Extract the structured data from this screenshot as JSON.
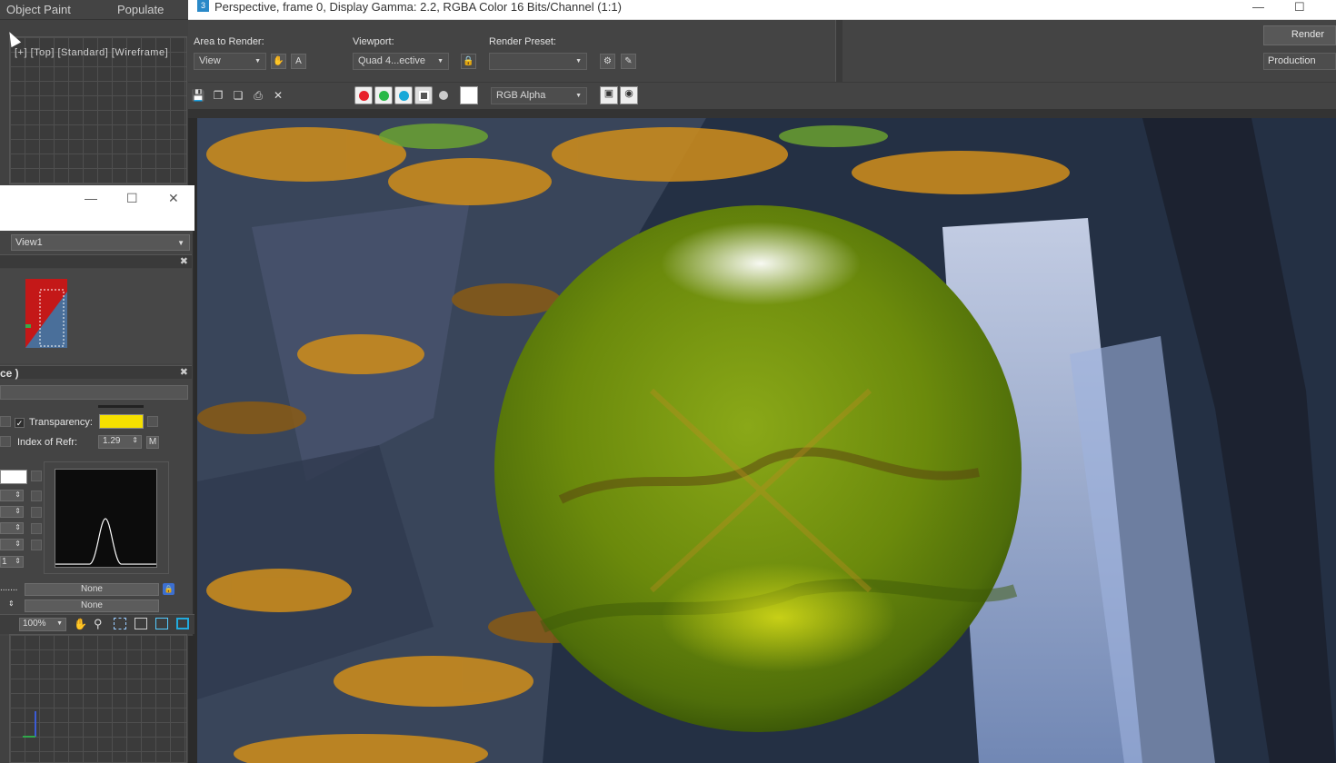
{
  "main_menu": {
    "object_paint": "Object Paint",
    "populate": "Populate"
  },
  "top_viewport": {
    "label": "[+] [Top] [Standard] [Wireframe]"
  },
  "material_editor": {
    "view_select": "View1",
    "panel_title": "ce )",
    "transparency_label": "Transparency:",
    "transparency_color": "#f5e000",
    "ior_label": "Index of Refr:",
    "ior_value": "1.29",
    "ior_map_btn": "M",
    "spinner_last": "1",
    "map_slot_1": "None",
    "map_slot_1_prefix": ".......",
    "map_slot_2": "None",
    "zoom": "100%"
  },
  "render_frame": {
    "title": "Perspective, frame 0, Display Gamma: 2.2, RGBA Color 16 Bits/Channel (1:1)",
    "app_icon": "3",
    "area_to_render_label": "Area to Render:",
    "area_to_render_value": "View",
    "viewport_label": "Viewport:",
    "viewport_value": "Quad 4...ective",
    "render_preset_label": "Render Preset:",
    "render_preset_value": "",
    "render_button": "Render",
    "production_value": "Production",
    "channel_display": "RGB Alpha"
  },
  "colors": {
    "red_channel": "#e8202a",
    "green_channel": "#28b846",
    "blue_channel": "#18a8d8",
    "sphere": "#7aa10a"
  }
}
